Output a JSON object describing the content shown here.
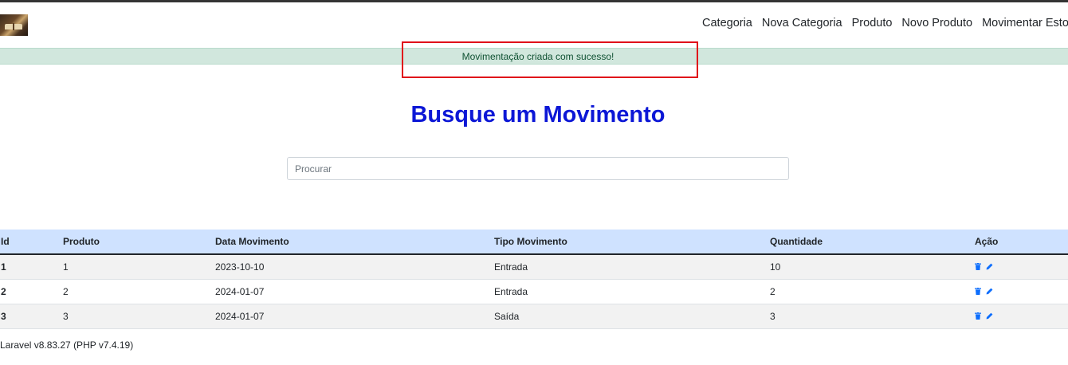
{
  "nav": {
    "items": [
      {
        "label": "Categoria"
      },
      {
        "label": "Nova Categoria"
      },
      {
        "label": "Produto"
      },
      {
        "label": "Novo Produto"
      },
      {
        "label": "Movimentar Estoque"
      }
    ]
  },
  "alert": {
    "message": "Movimentação criada com sucesso!"
  },
  "page": {
    "title": "Busque um Movimento"
  },
  "search": {
    "placeholder": "Procurar",
    "value": ""
  },
  "table": {
    "headers": [
      "Id",
      "Produto",
      "Data Movimento",
      "Tipo Movimento",
      "Quantidade",
      "Ação"
    ],
    "rows": [
      {
        "id": "1",
        "produto": "1",
        "data": "2023-10-10",
        "tipo": "Entrada",
        "quantidade": "10"
      },
      {
        "id": "2",
        "produto": "2",
        "data": "2024-01-07",
        "tipo": "Entrada",
        "quantidade": "2"
      },
      {
        "id": "3",
        "produto": "3",
        "data": "2024-01-07",
        "tipo": "Saída",
        "quantidade": "3"
      }
    ]
  },
  "footer": {
    "text": "Laravel v8.83.27 (PHP v7.4.19)"
  },
  "colors": {
    "title": "#0c17d6",
    "alert_bg": "#d1e7dd",
    "header_bg": "#cfe2ff",
    "action_icons": "#0d6efd",
    "highlight": "#e0101a"
  }
}
